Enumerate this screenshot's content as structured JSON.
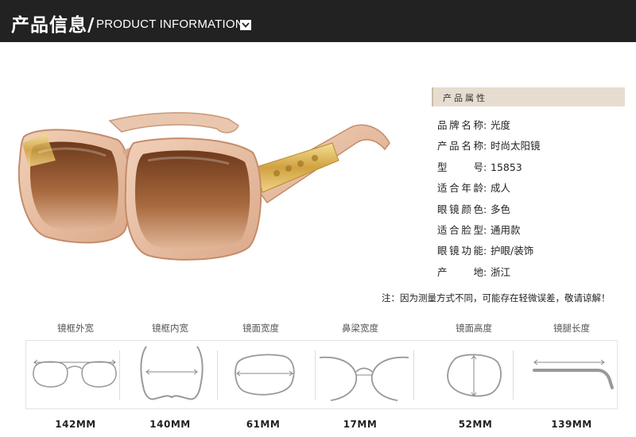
{
  "header": {
    "title_cn": "产品信息/",
    "title_en": "PRODUCT INFORMATION"
  },
  "product": {
    "icon": "sunglasses-product-photo",
    "colors": {
      "frame": "#e8c2a8",
      "lens": "#8a4e28",
      "temple_gold": "#d9b24e"
    }
  },
  "attributes": {
    "heading": "产品属性",
    "rows": [
      {
        "key": "品牌名称",
        "value": "光度"
      },
      {
        "key": "产品名称",
        "value": "时尚太阳镜"
      },
      {
        "key": "型号",
        "value": "15853"
      },
      {
        "key": "适合年龄",
        "value": "成人"
      },
      {
        "key": "眼镜颜色",
        "value": "多色"
      },
      {
        "key": "适合脸型",
        "value": "通用款"
      },
      {
        "key": "眼镜功能",
        "value": "护眼/装饰"
      },
      {
        "key": "产地",
        "value": "浙江"
      }
    ]
  },
  "note": "注：因为测量方式不同，可能存在轻微误差，敬请谅解！",
  "measurements": [
    {
      "label": "镜框外宽",
      "value": "142MM",
      "icon": "frame-outer-width-icon"
    },
    {
      "label": "镜框内宽",
      "value": "140MM",
      "icon": "frame-inner-width-icon"
    },
    {
      "label": "镜面宽度",
      "value": "61MM",
      "icon": "lens-width-icon"
    },
    {
      "label": "鼻梁宽度",
      "value": "17MM",
      "icon": "bridge-width-icon"
    },
    {
      "label": "镜面高度",
      "value": "52MM",
      "icon": "lens-height-icon"
    },
    {
      "label": "镜腿长度",
      "value": "139MM",
      "icon": "temple-length-icon"
    }
  ]
}
